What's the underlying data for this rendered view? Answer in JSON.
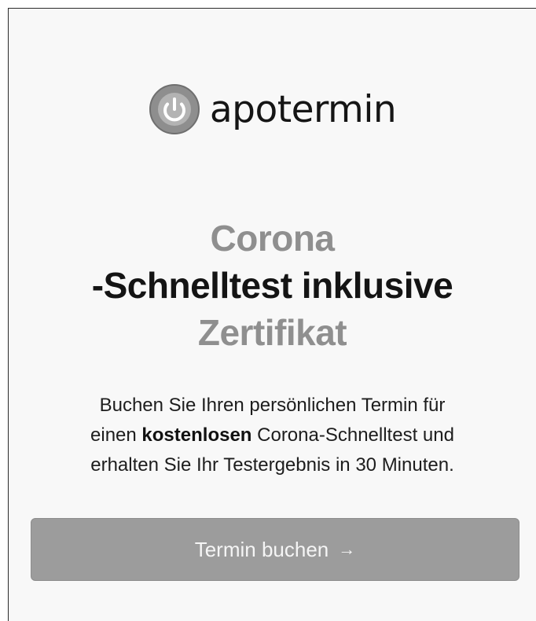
{
  "brand": {
    "name": "apotermin",
    "logo_icon": "power-button-icon"
  },
  "headline": {
    "line1": "Corona",
    "line2": "-Schnelltest inklusive",
    "line3": "Zertifikat"
  },
  "description": {
    "line1": "Buchen Sie Ihren persönlichen Termin für",
    "line2_prefix": "einen ",
    "line2_bold": "kostenlosen",
    "line2_suffix": " Corona-Schnelltest und",
    "line3": "erhalten Sie Ihr Testergebnis in 30 Minuten."
  },
  "cta": {
    "label": "Termin buchen",
    "arrow": "→"
  },
  "colors": {
    "page_background": "#f8f8f8",
    "accent_text": "#8f8f8f",
    "button_background": "#9c9c9c",
    "button_text": "#f5f5f5"
  }
}
